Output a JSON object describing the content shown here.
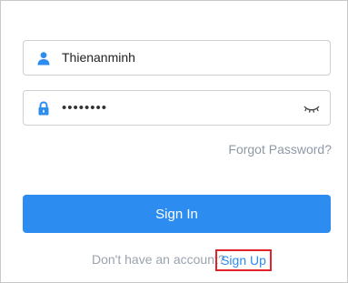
{
  "username_field": {
    "value": "Thienanminh",
    "icon": "user-icon"
  },
  "password_field": {
    "value": "••••••••",
    "icon": "lock-icon",
    "toggle_icon": "eye-closed-icon"
  },
  "forgot_password": {
    "label": "Forgot Password?"
  },
  "signin_button": {
    "label": "Sign In",
    "color": "#2d8cf0"
  },
  "signup": {
    "prompt": "Don't have an account?",
    "link_label": "Sign Up",
    "highlight_color": "#e2232b"
  }
}
